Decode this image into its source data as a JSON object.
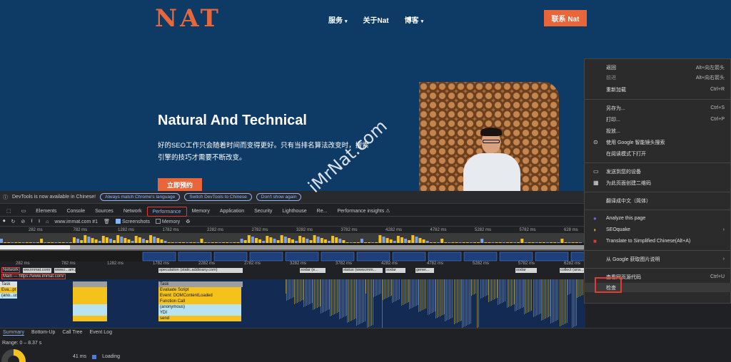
{
  "site": {
    "logo": "NAT",
    "nav": [
      {
        "label": "服务",
        "caret": "▾"
      },
      {
        "label": "关于Nat",
        "caret": ""
      },
      {
        "label": "博客",
        "caret": "▾"
      }
    ],
    "contact": "联系 Nat",
    "hero_title": "Natural And Technical",
    "hero_desc": "好的SEO工作只会随着时间而变得更好。只有当排名算法改变时，搜索引擎的技巧才需要不断改变。",
    "hero_button": "立即预约",
    "watermark": "iMrNat.com"
  },
  "devtools": {
    "info_message": "DevTools is now available in Chinese!",
    "info_buttons": [
      "Always match Chrome's language",
      "Switch DevTools to Chinese",
      "Don't show again"
    ],
    "tabs": [
      "Elements",
      "Console",
      "Sources",
      "Network",
      "Performance",
      "Memory",
      "Application",
      "Security",
      "Lighthouse",
      "Re...",
      "Performance insights ⚠"
    ],
    "active_tab": "Performance",
    "toolbar": {
      "url": "www.immat.com #1",
      "screenshots": "Screenshots",
      "memory": "Memory"
    },
    "ruler_top": [
      "282 ms",
      "782 ms",
      "1282 ms",
      "1782 ms",
      "2282 ms",
      "2782 ms",
      "3282 ms",
      "3782 ms",
      "4282 ms",
      "4782 ms",
      "5282 ms",
      "5782 ms",
      "628 ms"
    ],
    "ruler_bottom": [
      "282 ms",
      "782 ms",
      "1282 ms",
      "1782 ms",
      "2282 ms",
      "2782 ms",
      "3282 ms",
      "3782 ms",
      "4282 ms",
      "4782 ms",
      "5282 ms",
      "5782 ms",
      "6282 ms"
    ],
    "network_label": "Network",
    "network_items": [
      "ww.immat.com/",
      "www.i...am.js.com",
      "speculation (static.addtoany.com)",
      "sodar (e...",
      "status (www.imm...",
      "sodar",
      "gener...",
      "sodar",
      "collect (ana..."
    ],
    "main_label": "Main — https://www.immat.com/",
    "flame": [
      {
        "label": "Task",
        "color": "#9e9e9e"
      },
      {
        "label": "Evaluate Script",
        "color": "#f4c21b"
      },
      {
        "label": "Event: DOMContentLoaded",
        "color": "#f4c21b"
      },
      {
        "label": "Function Call",
        "color": "#f4c21b"
      },
      {
        "label": "(anonymous)",
        "color": "#b9e3f0"
      },
      {
        "label": "YDI",
        "color": "#b9e3f0"
      },
      {
        "label": "send",
        "color": "#f4c21b"
      }
    ],
    "flame_side": [
      "Eva...pt",
      "(ano...us)"
    ],
    "bottom_tabs": [
      "Summary",
      "Bottom-Up",
      "Call Tree",
      "Event Log"
    ],
    "range": "Range: 0 – 8.37 s",
    "legend": {
      "value": "41 ms",
      "label": "Loading"
    }
  },
  "context_menu": {
    "items": [
      {
        "label": "返回",
        "shortcut": "Alt+向左箭头",
        "dim": false,
        "icon": ""
      },
      {
        "label": "前进",
        "shortcut": "Alt+向右箭头",
        "dim": true,
        "icon": ""
      },
      {
        "label": "重新加载",
        "shortcut": "Ctrl+R",
        "dim": false,
        "icon": ""
      },
      {
        "label": "另存为...",
        "shortcut": "Ctrl+S",
        "dim": false,
        "icon": ""
      },
      {
        "label": "打印...",
        "shortcut": "Ctrl+P",
        "dim": false,
        "icon": ""
      },
      {
        "label": "投放...",
        "shortcut": "",
        "dim": false,
        "icon": ""
      },
      {
        "label": "使用 Google 智能镜头搜索",
        "shortcut": "",
        "dim": false,
        "icon": "lens"
      },
      {
        "label": "在阅读模式下打开",
        "shortcut": "",
        "dim": false,
        "icon": ""
      },
      {
        "label": "发送到您的设备",
        "shortcut": "",
        "dim": false,
        "icon": "device"
      },
      {
        "label": "为此页面创建二维码",
        "shortcut": "",
        "dim": false,
        "icon": "qr"
      },
      {
        "label": "翻译成中文（简体）",
        "shortcut": "",
        "dim": false,
        "icon": ""
      },
      {
        "label": "Analyze this page",
        "shortcut": "",
        "dim": false,
        "icon": "analyze"
      },
      {
        "label": "SEOquake",
        "shortcut": "›",
        "dim": false,
        "icon": "seoquake"
      },
      {
        "label": "Translate to Simplified Chinese(Alt+A)",
        "shortcut": "",
        "dim": false,
        "icon": "translate"
      },
      {
        "label": "从 Google 获取图片说明",
        "shortcut": "›",
        "dim": false,
        "icon": ""
      },
      {
        "label": "查看网页源代码",
        "shortcut": "Ctrl+U",
        "dim": false,
        "icon": ""
      },
      {
        "label": "检查",
        "shortcut": "",
        "dim": false,
        "icon": ""
      }
    ]
  }
}
